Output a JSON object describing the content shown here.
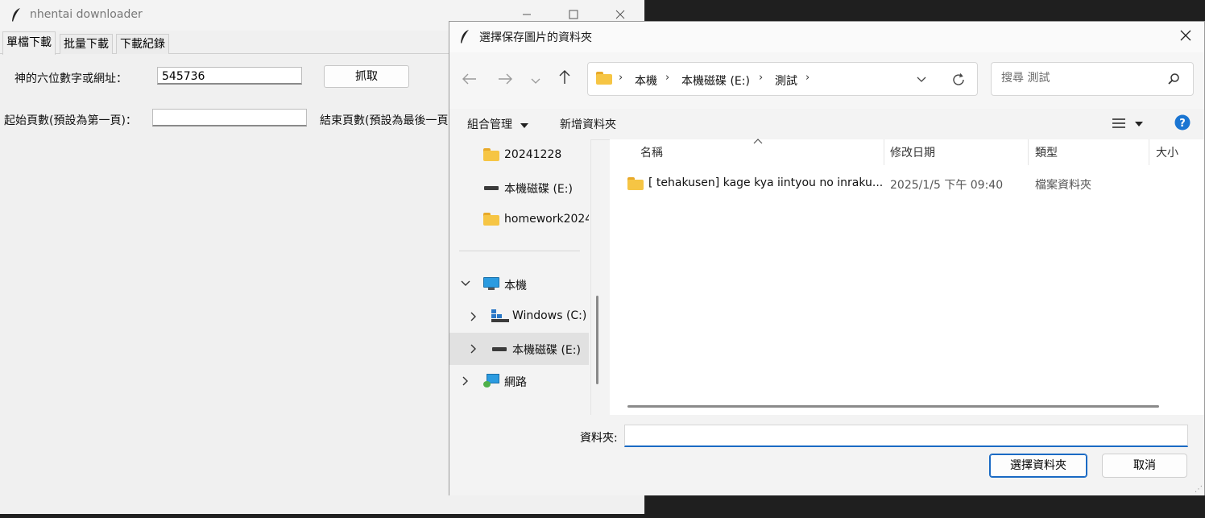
{
  "main_window": {
    "title": "nhentai downloader",
    "tabs": [
      "單檔下載",
      "批量下載",
      "下載紀錄"
    ],
    "code_label": "神的六位數字或網址：",
    "code_value": "545736",
    "fetch_button": "抓取",
    "start_label": "起始頁數(預設為第一頁)：",
    "start_value": "",
    "end_label": "結束頁數(預設為最後一頁)"
  },
  "dialog": {
    "title": "選擇保存圖片的資料夾",
    "breadcrumbs": [
      "本機",
      "本機磁碟 (E:)",
      "測試"
    ],
    "search_placeholder": "搜尋 測試",
    "commands": {
      "organize": "組合管理",
      "new_folder": "新增資料夾"
    },
    "nav_items": [
      {
        "label": "20241228",
        "icon": "folder-icon"
      },
      {
        "label": "本機磁碟 (E:)",
        "icon": "drive-icon"
      },
      {
        "label": "homework2024",
        "icon": "folder-icon"
      },
      {
        "label": "本機",
        "icon": "pc-icon"
      },
      {
        "label": "Windows (C:)",
        "icon": "windows-drive-icon"
      },
      {
        "label": "本機磁碟 (E:)",
        "icon": "drive-icon"
      },
      {
        "label": "網路",
        "icon": "network-icon"
      }
    ],
    "columns": [
      "名稱",
      "修改日期",
      "類型",
      "大小"
    ],
    "files": [
      {
        "name": "[ tehakusen] kage kya iintyou no inraku...",
        "modified": "2025/1/5 下午 09:40",
        "type": "檔案資料夾"
      }
    ],
    "folder_label": "資料夾:",
    "folder_value": "",
    "select_button": "選擇資料夾",
    "cancel_button": "取消"
  },
  "colors": {
    "accent": "#1a6ac4",
    "folder": "#f6c544",
    "help": "#1a75d2"
  }
}
